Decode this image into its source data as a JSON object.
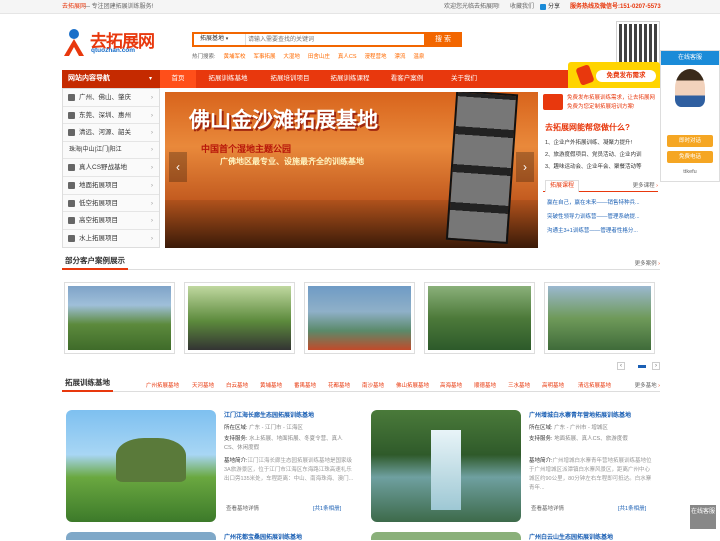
{
  "topbar": {
    "site": "去拓展网",
    "slogan": "— 专注团建拓展训练服务!",
    "welcome": "欢迎您光临去拓展网!",
    "favorite": "收藏我们",
    "share": "分享",
    "hotline": "服务热线及微信号:151-0207-5573"
  },
  "logo": {
    "name": "去拓展网",
    "domain": "qtuozhan.com"
  },
  "search": {
    "category": "拓展基地",
    "placeholder": "请输入需要查找的关键词",
    "button": "搜 索",
    "hot_label": "热门搜索:",
    "hot": [
      "黄埔军校",
      "军事拓展",
      "大湿地",
      "田舍山庄",
      "真人CS",
      "漫程营地",
      "漂流",
      "温泉"
    ]
  },
  "nav": {
    "side_title": "网站内容导航",
    "items": [
      "首页",
      "拓展训练基地",
      "拓展培训项目",
      "拓展训练课程",
      "看客户案例",
      "关于我们"
    ]
  },
  "sidebar": [
    "广州、佛山、肇庆",
    "东莞、深圳、惠州",
    "清远、河源、韶关",
    "珠海|中山|江门|阳江",
    "真人CS野战基地",
    "地面拓展项目",
    "低空拓展项目",
    "高空拓展项目",
    "水上拓展项目"
  ],
  "banner": {
    "title": "佛山金沙滩拓展基地",
    "line1": "中国首个湿地主题公园",
    "line2": "广佛地区最专业、设施最齐全的训练基地"
  },
  "right_panel": {
    "free_design": "免费发布拓展训练需求，让去拓展网免费为您定制拓展培训方案!",
    "question": "去拓展网能帮您做什么?",
    "list": [
      "1、企业户外拓展训练、凝聚力提升!",
      "2、旅游度假项目、党员活动、企业内训",
      "3、趣味运动会、企业年会、聚餐活动等"
    ],
    "course_tab": "拓展课程",
    "more_course": "更多课程",
    "courses": [
      "赢在自己，赢在未来——销售特种兵...",
      "突破性领导力训练营——管理系统提...",
      "沟通主3+1训练营——管理者性格分..."
    ],
    "publish_btn": "免费发布需求"
  },
  "cases": {
    "title": "部分客户案例展示",
    "more": "更多案例"
  },
  "bases": {
    "title": "拓展训练基地",
    "tabs": [
      "广州拓展基地",
      "天河基地",
      "白云基地",
      "黄埔基地",
      "番禺基地",
      "花都基地",
      "南沙基地",
      "佛山拓展基地",
      "高海基地",
      "顺德基地",
      "三水基地",
      "高明基地",
      "清远拓展基地"
    ],
    "more": "更多基地",
    "cards": [
      {
        "title": "江门江海长廊生态园拓展训练基地",
        "area_label": "所在区域:",
        "area": "广东 - 江门市 - 江海区",
        "projects_label": "支持服务:",
        "projects": "水上拓展、地面拓展、冬夏令营、真人CS、休闲度假",
        "intro_label": "基地简介:",
        "intro": "江门江海长廊生态园拓展训练基地是国家级3A旅游景区，位于江门市江海区东海路江珠高速礼乐出口旁135米处，车程距离：中山、南海珠海、澳门...",
        "link": "查看基地详情",
        "count": "[共1条相册]"
      },
      {
        "title": "广州增城白水寨青年营地拓展训练基地",
        "area_label": "所在区域:",
        "area": "广东 - 广州市 - 增城区",
        "projects_label": "支持服务:",
        "projects": "地面拓展、真人CS、旅游度假",
        "intro_label": "基地简介:",
        "intro": "广州增城白水寨青年营地拓展训练基地位于广州增城区派潭镇白水寨风景区，距离广州中心城区约90公里，80分钟左右车程即可抵达。白水寨青年...",
        "link": "查看基地详情",
        "count": "[共1条相册]"
      }
    ],
    "next_titles": [
      "广州花都宝桑园拓展训练基地",
      "广州白云山生态园拓展训练基地"
    ]
  },
  "float": {
    "title": "在线客服",
    "btn1": "即时对话",
    "btn2": "免费电话",
    "id": "ttkefu",
    "small": "在线客服"
  }
}
